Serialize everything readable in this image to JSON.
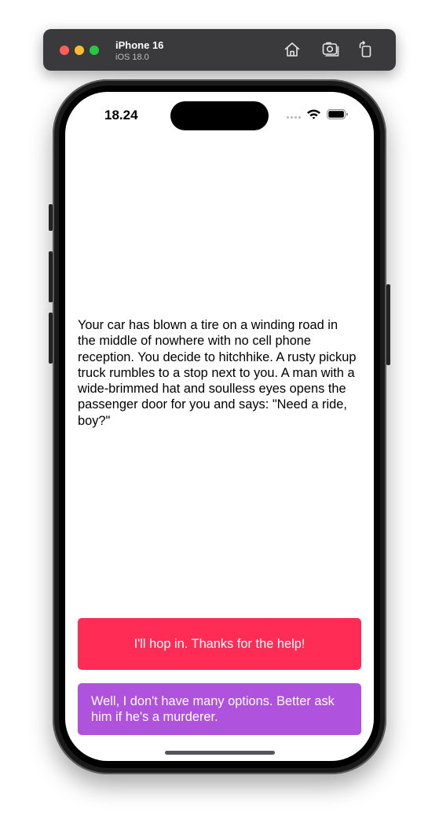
{
  "simulator": {
    "device_name": "iPhone 16",
    "os_version": "iOS 18.0",
    "toolbar_icons": [
      "home-icon",
      "screenshot-icon",
      "rotate-icon"
    ]
  },
  "status_bar": {
    "time": "18.24",
    "icons": [
      "cellular-signal-icon",
      "wifi-icon",
      "battery-icon"
    ]
  },
  "story": {
    "text": "Your car has blown a tire on a winding road in the middle of nowhere with no cell phone reception. You decide to hitchhike. A rusty pickup truck rumbles to a stop next to you. A man with a wide-brimmed hat and soulless eyes opens the passenger door for you and says: \"Need a ride, boy?\""
  },
  "choices": [
    {
      "label": "I'll hop in. Thanks for the help!",
      "color": "#ff2d55"
    },
    {
      "label": "Well, I don't have many options. Better ask him if he's a murderer.",
      "color": "#af52de"
    }
  ],
  "colors": {
    "toolbar_bg": "#3a3a3c",
    "screen_bg": "#ffffff",
    "text": "#000000"
  }
}
